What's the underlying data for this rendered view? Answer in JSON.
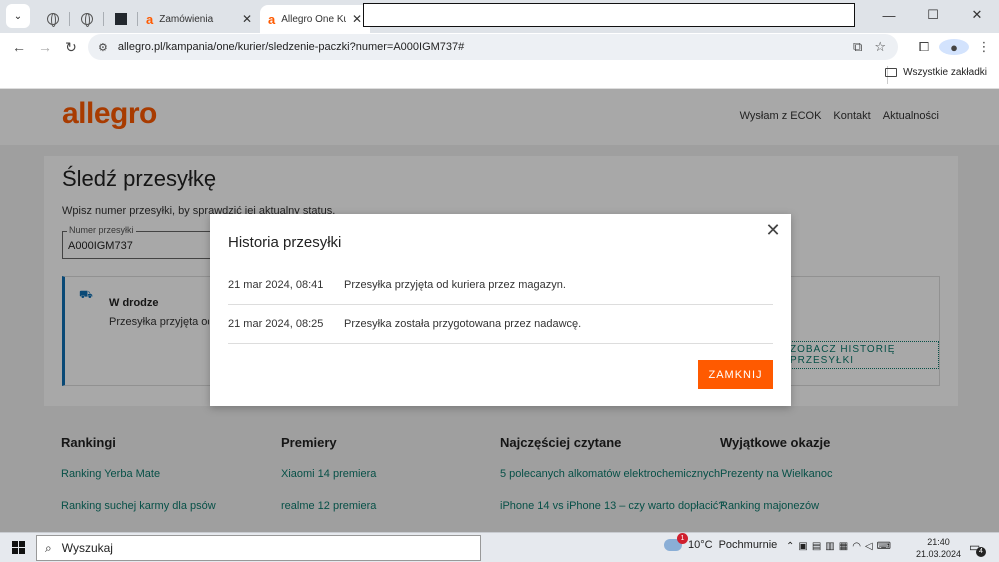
{
  "browser": {
    "tabs": [
      {
        "label": "",
        "type": "pinned-globe"
      },
      {
        "label": "",
        "type": "pinned-globe"
      },
      {
        "label": "",
        "type": "pinned-dark"
      },
      {
        "label": "Zamówienia",
        "type": "normal"
      },
      {
        "label": "Allegro One Kuri",
        "type": "active"
      }
    ],
    "url": "allegro.pl/kampania/one/kurier/sledzenie-paczki?numer=A000IGM737#",
    "bookmarks_all_label": "Wszystkie zakładki"
  },
  "site": {
    "logo": "allegro",
    "top_links": [
      "Wysłam z ECOK",
      "Kontakt",
      "Aktualności"
    ]
  },
  "tracking": {
    "title": "Śledź przesyłkę",
    "subtitle": "Wpisz numer przesyłki, by sprawdzić jej aktualny status.",
    "field_label": "Numer przesyłki",
    "field_value": "A000IGM737",
    "status_title": "W drodze",
    "status_text": "Przesyłka przyjęta od kuriera przez magazyn.",
    "history_button": "Zobacz historię przesyłki"
  },
  "footer": {
    "columns": [
      {
        "title": "Rankingi",
        "links": [
          "Ranking Yerba Mate",
          "Ranking suchej karmy dla psów"
        ]
      },
      {
        "title": "Premiery",
        "links": [
          "Xiaomi 14 premiera",
          "realme 12 premiera"
        ]
      },
      {
        "title": "Najczęściej czytane",
        "links": [
          "5 polecanych alkomatów elektrochemicznych",
          "iPhone 14 vs iPhone 13 – czy warto dopłacić?"
        ]
      },
      {
        "title": "Wyjątkowe okazje",
        "links": [
          "Prezenty na Wielkanoc",
          "Ranking majonezów"
        ]
      }
    ]
  },
  "modal": {
    "title": "Historia przesyłki",
    "history": [
      {
        "date": "21 mar 2024, 08:41",
        "text": "Przesyłka przyjęta od kuriera przez magazyn."
      },
      {
        "date": "21 mar 2024, 08:25",
        "text": "Przesyłka została przygotowana przez nadawcę."
      }
    ],
    "close_button": "ZAMKNIJ"
  },
  "taskbar": {
    "search_placeholder": "Wyszukaj",
    "weather_temp": "10°C",
    "weather_desc": "Pochmurnie",
    "weather_badge": "1",
    "time": "21:40",
    "date": "21.03.2024",
    "notifications": "4"
  },
  "colors": {
    "brand": "#ff5a00",
    "link": "#0b7a6d",
    "status_accent": "#0e6fb3"
  }
}
